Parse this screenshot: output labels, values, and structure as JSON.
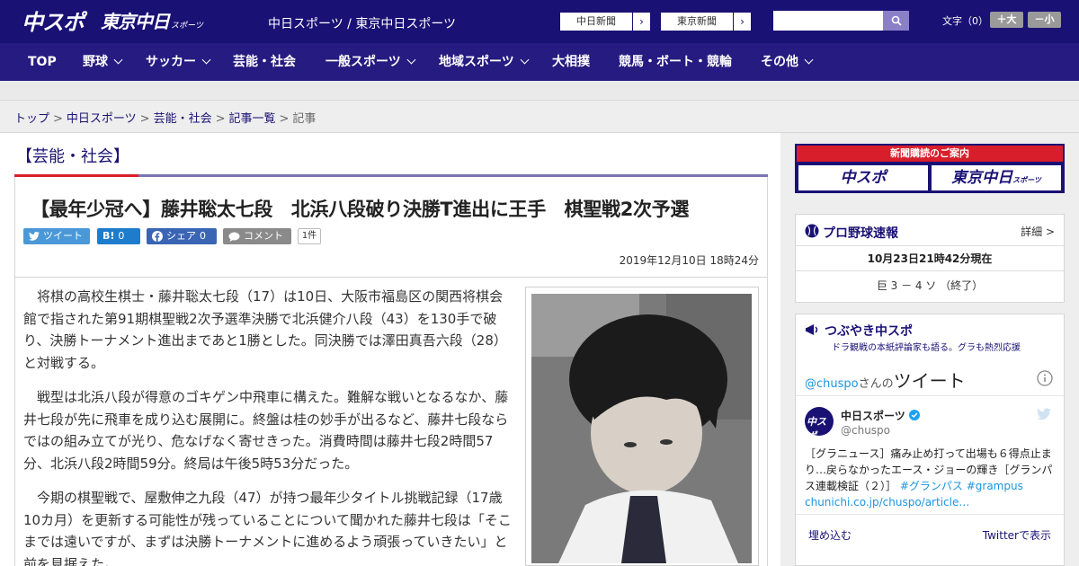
{
  "header": {
    "logo_chuspo": "中スポ",
    "logo_tokyo": "東京中日",
    "logo_tokyo_sub": "スポーツ",
    "site_title": "中日スポーツ / 東京中日スポーツ",
    "ext_links": [
      "中日新聞",
      "東京新聞"
    ],
    "search": {
      "placeholder": ""
    },
    "font_size_label": "文字（0）",
    "font_larger": "＋大",
    "font_smaller": "－小"
  },
  "nav": {
    "items": [
      {
        "label": "TOP",
        "dropdown": false
      },
      {
        "label": "野球",
        "dropdown": true
      },
      {
        "label": "サッカー",
        "dropdown": true
      },
      {
        "label": "芸能・社会",
        "dropdown": false
      },
      {
        "label": "一般スポーツ",
        "dropdown": true
      },
      {
        "label": "地域スポーツ",
        "dropdown": true
      },
      {
        "label": "大相撲",
        "dropdown": false
      },
      {
        "label": "競馬・ボート・競輪",
        "dropdown": false
      },
      {
        "label": "その他",
        "dropdown": true
      }
    ]
  },
  "breadcrumb": {
    "items": [
      "トップ",
      "中日スポーツ",
      "芸能・社会",
      "記事一覧"
    ],
    "current": "記事"
  },
  "category_title": "【芸能・社会】",
  "article": {
    "headline": "【最年少冠へ】藤井聡太七段　北浜八段破り決勝T進出に王手　棋聖戦2次予選",
    "share": {
      "tweet": "ツイート",
      "hatena": "B!",
      "hatena_count": "0",
      "facebook": "シェア",
      "facebook_count": "0",
      "comment": "コメント",
      "comment_count": "1件"
    },
    "date": "2019年12月10日 18時24分",
    "paragraphs": [
      "将棋の高校生棋士・藤井聡太七段（17）は10日、大阪市福島区の関西将棋会館で指された第91期棋聖戦2次予選準決勝で北浜健介八段（43）を130手で破り、決勝トーナメント進出まであと1勝とした。同決勝では澤田真吾六段（28）と対戦する。",
      "戦型は北浜八段が得意のゴキゲン中飛車に構えた。難解な戦いとなるなか、藤井七段が先に飛車を成り込む展開に。終盤は桂の妙手が出るなど、藤井七段ならではの組み立てが光り、危なげなく寄せきった。消費時間は藤井七段2時間57分、北浜八段2時間59分。終局は午後5時53分だった。",
      "今期の棋聖戦で、屋敷伸之九段（47）が持つ最年少タイトル挑戦記録（17歳10カ月）を更新する可能性が残っていることについて聞かれた藤井七段は「そこまでは遠いですが、まずは決勝トーナメントに進めるよう頑張っていきたい」と前を見据えた。"
    ]
  },
  "sidebar": {
    "ad": {
      "label": "新聞購読のご案内",
      "logo_chuspo": "中スポ",
      "logo_tokyo": "東京中日",
      "logo_tokyo_sub": "スポーツ"
    },
    "baseball": {
      "title": "プロ野球速報",
      "more": "詳細 >",
      "timestamp": "10月23日21時42分現在",
      "score": "巨 3 － 4 ソ （終了）"
    },
    "twitter_widget": {
      "title": "つぶやき中スポ",
      "subtitle": "ドラ観戦の本紙評論家も語る。グラも熱烈応援"
    },
    "tweets_card": {
      "handle_link": "@chuspo",
      "handle_suffix": "さんの",
      "heading": "ツイート",
      "author_name": "中日スポーツ",
      "author_handle": "@chuspo",
      "tweet_text": "［グラニュース］痛み止め打って出場も６得点止まり…戻らなかったエース・ジョーの輝き［グランパス連載検証（２）］",
      "hashtags": "#グランパス #grampus",
      "link": "chunichi.co.jp/chuspo/article…",
      "embed": "埋め込む",
      "view_on_twitter": "Twitterで表示"
    }
  },
  "colors": {
    "header_bg": "#1a1175",
    "nav_bg": "#261b80",
    "accent_red": "#d81e2a",
    "link": "#1a1175"
  }
}
